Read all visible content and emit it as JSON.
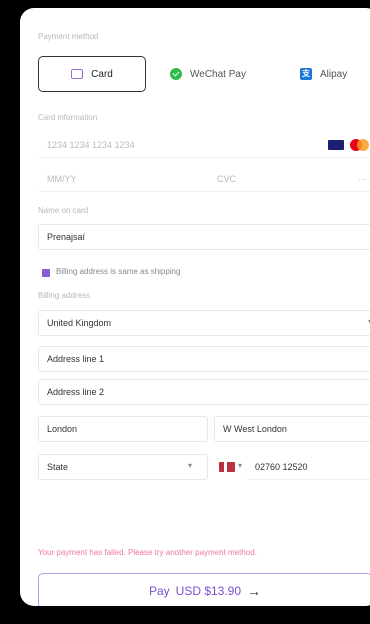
{
  "payment_method_label": "Payment method",
  "tabs": [
    {
      "label": "Card",
      "icon": "card-icon"
    },
    {
      "label": "WeChat Pay",
      "icon": "wechat-icon"
    },
    {
      "label": "Alipay",
      "icon": "alipay-icon"
    }
  ],
  "card_information_label": "Card information",
  "card_number_placeholder": "1234 1234 1234 1234",
  "expiry_placeholder": "MM/YY",
  "cvc_placeholder": "CVC",
  "name_on_card_label": "Name on card",
  "name_on_card_value": "Prenajsaí",
  "billing_same_label": "Billing address is same as shipping",
  "billing_address_label": "Billing address",
  "country_value": "United Kingdom",
  "address_line1_placeholder": "Address line 1",
  "address_line2_placeholder": "Address line 2",
  "city_value": "London",
  "region_value": "W West London",
  "state_placeholder": "State",
  "phone_value": "02760 12520",
  "error_message": "Your payment has failed. Please try another payment method.",
  "pay_button": {
    "label": "Pay",
    "amount": "USD $13.90",
    "arrow": "→"
  },
  "colors": {
    "accent": "#8a5bd6",
    "error": "#ee7a96",
    "wechat": "#2dbb4e",
    "alipay": "#1a78d6"
  }
}
